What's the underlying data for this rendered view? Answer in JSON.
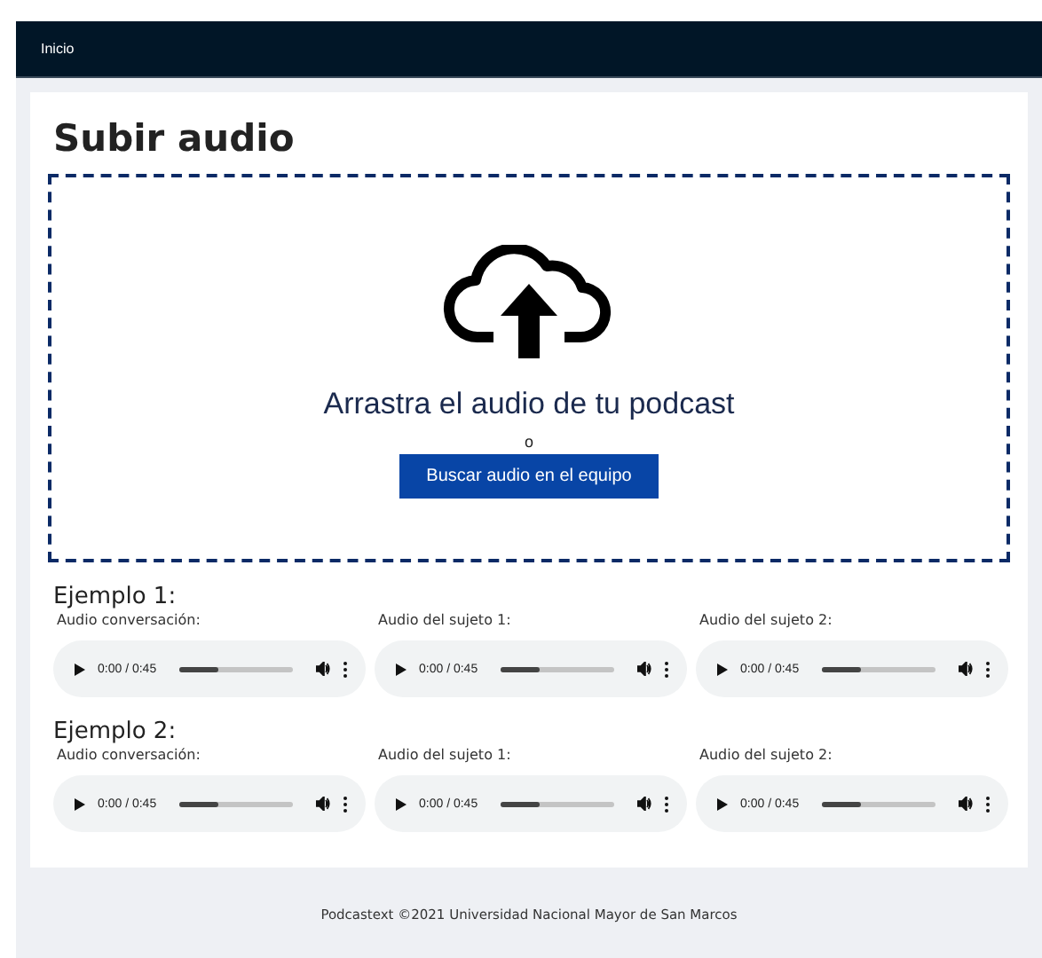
{
  "navbar": {
    "links": [
      "Inicio"
    ]
  },
  "title": "Subir audio",
  "dropzone": {
    "prompt": "Arrastra el audio de tu podcast",
    "separator": "o",
    "button": "Buscar audio en el equipo"
  },
  "examples": [
    {
      "heading": "Ejemplo 1:",
      "players": [
        {
          "label": "Audio conversación:",
          "time": "0:00 / 0:45",
          "level": 0.35
        },
        {
          "label": "Audio del sujeto 1:",
          "time": "0:00 / 0:45",
          "level": 0.35
        },
        {
          "label": "Audio del sujeto 2:",
          "time": "0:00 / 0:45",
          "level": 0.35
        }
      ]
    },
    {
      "heading": "Ejemplo 2:",
      "players": [
        {
          "label": "Audio conversación:",
          "time": "0:00 / 0:45",
          "level": 0.35
        },
        {
          "label": "Audio del sujeto 1:",
          "time": "0:00 / 0:45",
          "level": 0.35
        },
        {
          "label": "Audio del sujeto 2:",
          "time": "0:00 / 0:45",
          "level": 0.35
        }
      ]
    }
  ],
  "footer": "Podcastext ©2021 Universidad Nacional Mayor de San Marcos"
}
